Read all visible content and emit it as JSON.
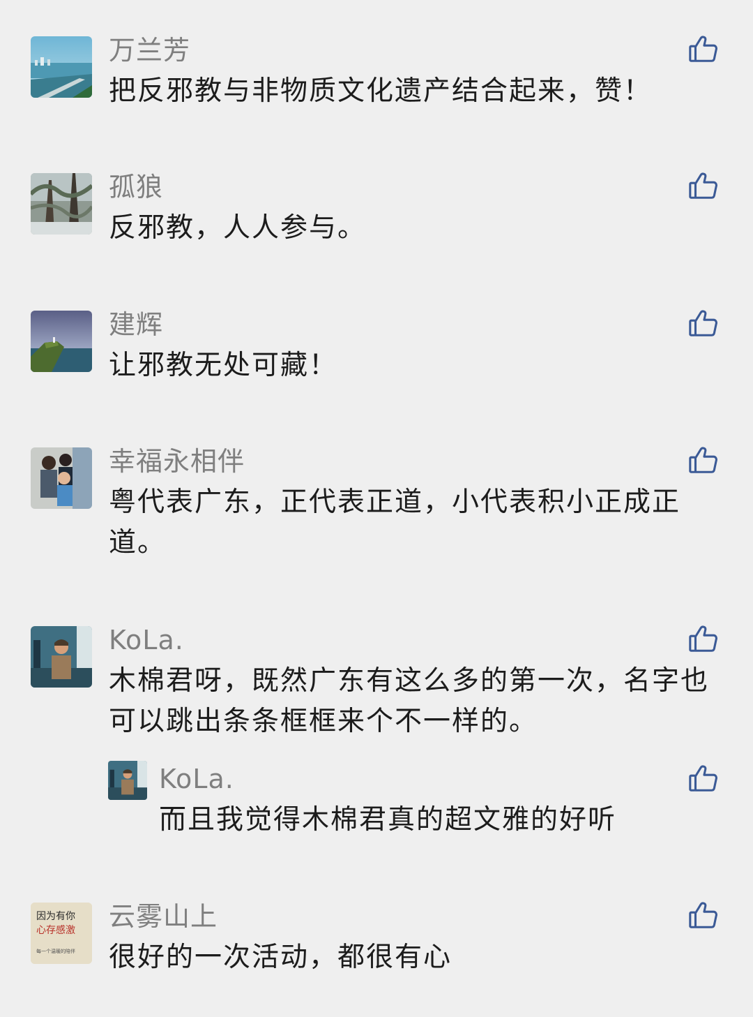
{
  "comments": [
    {
      "author": "万兰芳",
      "text": "把反邪教与非物质文化遗产结合起来，赞！"
    },
    {
      "author": "孤狼",
      "text": "反邪教，人人参与。"
    },
    {
      "author": "建辉",
      "text": "让邪教无处可藏！"
    },
    {
      "author": "幸福永相伴",
      "text": "粤代表广东，正代表正道，小代表积小正成正道。"
    },
    {
      "author": "KoLa.",
      "text": "木棉君呀，既然广东有这么多的第一次，名字也可以跳出条条框框来个不一样的。",
      "reply": {
        "author": "KoLa.",
        "text": "而且我觉得木棉君真的超文雅的好听"
      }
    },
    {
      "author": "云雾山上",
      "text": "很好的一次活动，都很有心"
    }
  ],
  "avatar6_text": {
    "line1": "因为有你",
    "line2": "心存感激",
    "line3": "每一个温暖的陪伴"
  },
  "icons": {
    "like": "thumbs-up-icon"
  },
  "colors": {
    "background": "#efefef",
    "name": "#7f7f7f",
    "text": "#1c1c1c",
    "like": "#3b5a96"
  }
}
